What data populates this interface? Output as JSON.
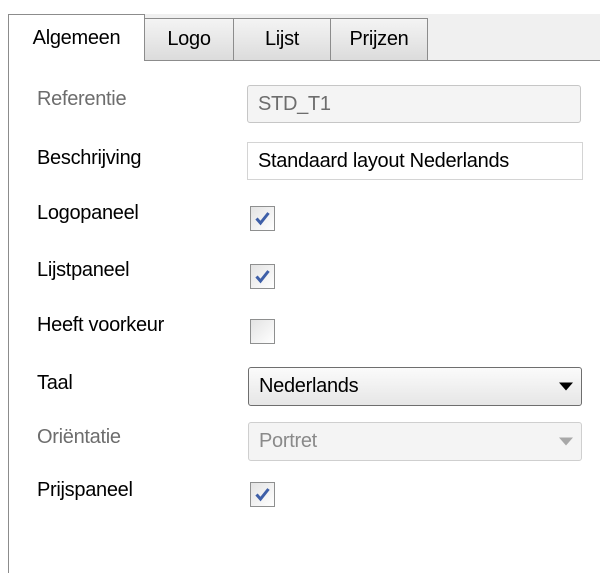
{
  "tabs": [
    {
      "label": "Algemeen",
      "active": true
    },
    {
      "label": "Logo",
      "active": false
    },
    {
      "label": "Lijst",
      "active": false
    },
    {
      "label": "Prijzen",
      "active": false
    }
  ],
  "form": {
    "referentie": {
      "label": "Referentie",
      "value": "STD_T1",
      "enabled": false
    },
    "beschrijving": {
      "label": "Beschrijving",
      "value": "Standaard layout Nederlands",
      "enabled": true
    },
    "logopaneel": {
      "label": "Logopaneel",
      "checked": true
    },
    "lijstpaneel": {
      "label": "Lijstpaneel",
      "checked": true
    },
    "heeft_voorkeur": {
      "label": "Heeft voorkeur",
      "checked": false
    },
    "taal": {
      "label": "Taal",
      "value": "Nederlands",
      "enabled": true
    },
    "orientatie": {
      "label": "Oriëntatie",
      "value": "Portret",
      "enabled": false
    },
    "prijspaneel": {
      "label": "Prijspaneel",
      "checked": true
    }
  },
  "colors": {
    "check": "#3e5fa8",
    "panel_bg": "#ffffff",
    "window_bg": "#f0f0f0",
    "disabled_text": "#6d6d6d"
  }
}
